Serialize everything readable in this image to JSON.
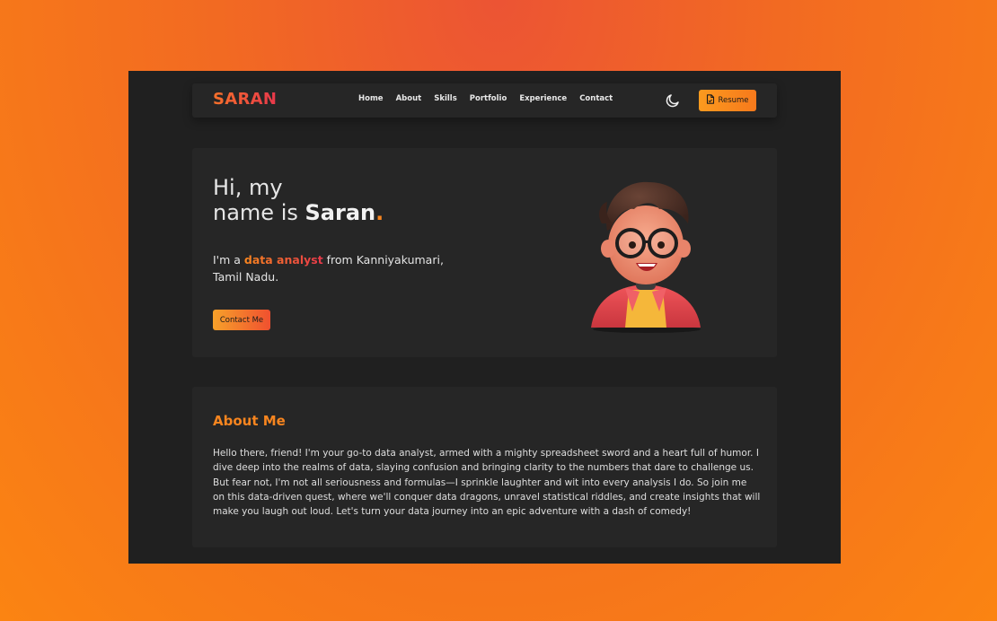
{
  "nav": {
    "logo": "SARAN",
    "links": [
      "Home",
      "About",
      "Skills",
      "Portfolio",
      "Experience",
      "Contact"
    ],
    "theme_icon": "moon-icon",
    "resume_label": "Resume",
    "resume_icon": "document-icon"
  },
  "hero": {
    "greeting_line1": "Hi, my",
    "greeting_line2_prefix": "name is ",
    "name": "Saran",
    "name_dot": ".",
    "intro_prefix": "I'm a ",
    "role": "data analyst",
    "intro_suffix": " from Kanniyakumari, Tamil Nadu.",
    "contact_label": "Contact Me"
  },
  "about": {
    "title": "About Me",
    "body": "Hello there, friend! I'm your go-to data analyst, armed with a mighty spreadsheet sword and a heart full of humor. I dive deep into the realms of data, slaying confusion and bringing clarity to the numbers that dare to challenge us. But fear not, I'm not all seriousness and formulas—I sprinkle laughter and wit into every analysis I do. So join me on this data-driven quest, where we'll conquer data dragons, unravel statistical riddles, and create insights that will make you laugh out loud. Let's turn your data journey into an epic adventure with a dash of comedy!"
  },
  "colors": {
    "page_bg_top": "#ec5434",
    "page_bg_bottom": "#fb8412",
    "window_bg": "#202020",
    "card_bg": "#262626",
    "accent_orange": "#f7851f",
    "accent_red": "#e8384b"
  }
}
